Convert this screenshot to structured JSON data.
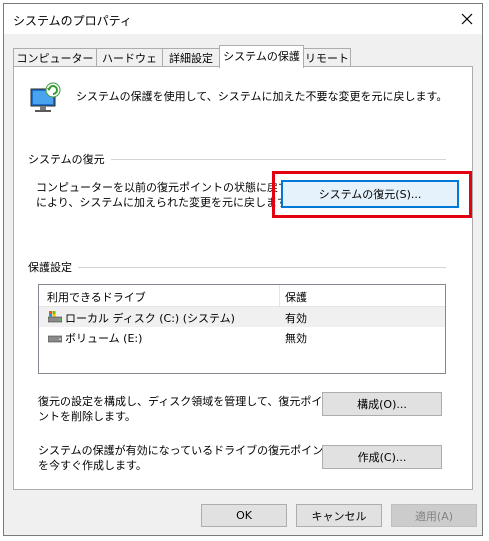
{
  "window": {
    "title": "システムのプロパティ"
  },
  "tabs": [
    {
      "label": "コンピューター名"
    },
    {
      "label": "ハードウェア"
    },
    {
      "label": "詳細設定"
    },
    {
      "label": "システムの保護"
    },
    {
      "label": "リモート"
    }
  ],
  "active_tab": 3,
  "intro": {
    "text": "システムの保護を使用して、システムに加えた不要な変更を元に戻します。"
  },
  "restore": {
    "group_label": "システムの復元",
    "description_line1": "コンピューターを以前の復元ポイントの状態に戻すこと",
    "description_line2": "により、システムに加えられた変更を元に戻します。",
    "button_label": "システムの復元(S)..."
  },
  "protection": {
    "group_label": "保護設定",
    "columns": {
      "drive": "利用できるドライブ",
      "status": "保護"
    },
    "drives": [
      {
        "name": "ローカル ディスク (C:) (システム)",
        "status": "有効",
        "icon": "system-drive-icon"
      },
      {
        "name": "ボリューム (E:)",
        "status": "無効",
        "icon": "drive-icon"
      }
    ],
    "configure": {
      "description_line1": "復元の設定を構成し、ディスク領域を管理して、復元ポイ",
      "description_line2": "ントを削除します。",
      "button_label": "構成(O)..."
    },
    "create": {
      "description_line1": "システムの保護が有効になっているドライブの復元ポイント",
      "description_line2": "を今すぐ作成します。",
      "button_label": "作成(C)..."
    }
  },
  "footer": {
    "ok": "OK",
    "cancel": "キャンセル",
    "apply": "適用(A)"
  },
  "colors": {
    "highlight": "#e3000f",
    "accent": "#0078d7"
  }
}
